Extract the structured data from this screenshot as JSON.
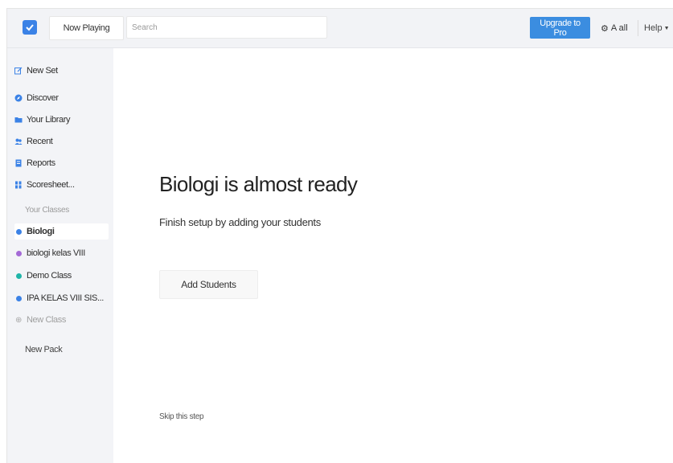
{
  "header": {
    "now_playing_label": "Now Playing",
    "search_placeholder": "Search",
    "upgrade_label": "Upgrade to Pro",
    "account_label": "A all",
    "help_label": "Help"
  },
  "sidebar": {
    "items": [
      {
        "label": "New Set",
        "icon": "edit-icon"
      },
      {
        "label": "Discover",
        "icon": "compass-icon"
      },
      {
        "label": "Your Library",
        "icon": "folder-icon"
      },
      {
        "label": "Recent",
        "icon": "people-icon"
      },
      {
        "label": "Reports",
        "icon": "report-icon"
      },
      {
        "label": "Scoresheet...",
        "icon": "grid-icon"
      }
    ],
    "classes_heading": "Your Classes",
    "classes": [
      {
        "label": "Biologi",
        "color": "#3b82e6",
        "selected": true
      },
      {
        "label": "biologi kelas VIII",
        "color": "#a46ad6",
        "selected": false
      },
      {
        "label": "Demo Class",
        "color": "#1fb5a8",
        "selected": false
      },
      {
        "label": "IPA KELAS VIII SIS...",
        "color": "#3b82e6",
        "selected": false
      }
    ],
    "new_class_label": "New Class",
    "new_pack_label": "New Pack"
  },
  "main": {
    "title": "Biologi is almost ready",
    "subtitle": "Finish setup by adding your students",
    "add_students_label": "Add Students",
    "skip_label": "Skip this step"
  },
  "colors": {
    "accent": "#3b8de0",
    "sidebar_bg": "#f3f4f7"
  }
}
